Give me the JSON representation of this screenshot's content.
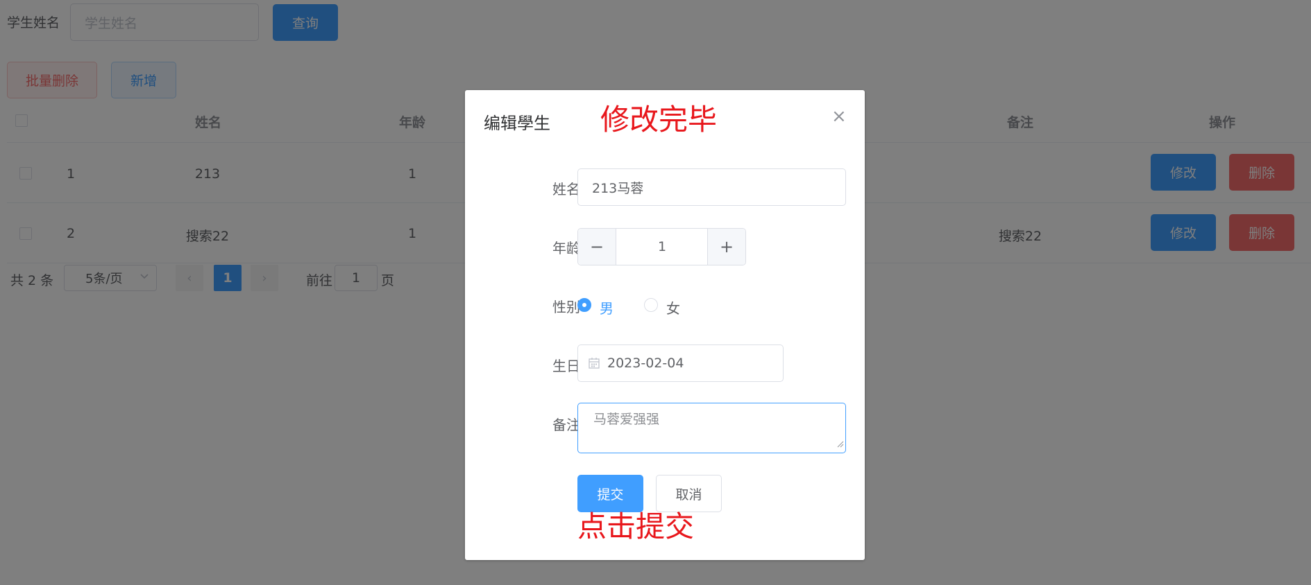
{
  "search": {
    "label": "学生姓名",
    "placeholder": "学生姓名",
    "query_button": "查询"
  },
  "toolbar": {
    "batch_delete": "批量删除",
    "add": "新增"
  },
  "table": {
    "headers": {
      "name": "姓名",
      "age": "年龄",
      "remark": "备注",
      "actions": "操作"
    },
    "rows": [
      {
        "id": "1",
        "name": "213",
        "age": "1",
        "remark": "",
        "edit": "修改",
        "delete": "删除"
      },
      {
        "id": "2",
        "name": "搜索22",
        "age": "1",
        "remark": "搜索22",
        "edit": "修改",
        "delete": "删除"
      }
    ]
  },
  "pagination": {
    "total": "共 2 条",
    "page_size": "5条/页",
    "current_page": "1",
    "goto_label": "前往",
    "goto_value": "1",
    "page_suffix": "页",
    "prev_icon": "‹",
    "next_icon": "›"
  },
  "dialog": {
    "title": "编辑學生",
    "annotation_top": "修改完毕",
    "close_icon": "×",
    "fields": {
      "name_label": "姓名",
      "name_value": "213马蓉",
      "age_label": "年龄",
      "age_value": "1",
      "minus": "−",
      "plus": "+",
      "gender_label": "性别",
      "gender_male": "男",
      "gender_female": "女",
      "gender_selected": "男",
      "birthday_label": "生日",
      "birthday_value": "2023-02-04",
      "remark_label": "备注",
      "remark_value": "马蓉爱强强"
    },
    "submit": "提交",
    "cancel": "取消",
    "annotation_bottom": "点击提交"
  },
  "colors": {
    "primary": "#409eff",
    "danger": "#f56c6c",
    "annotation": "#e8171c"
  }
}
